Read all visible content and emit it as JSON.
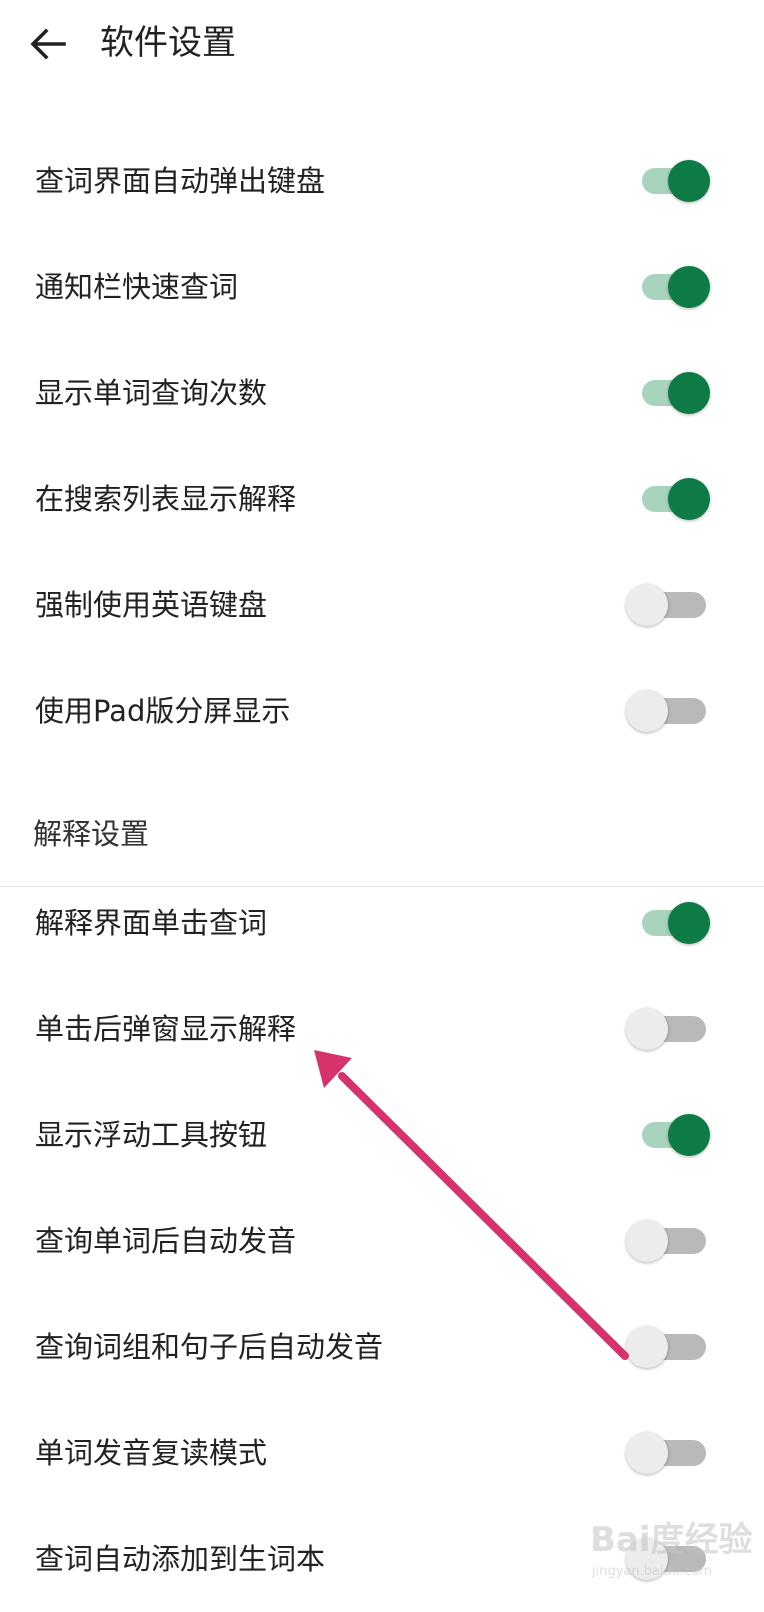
{
  "header": {
    "title": "软件设置",
    "back_icon": "arrow-left-icon"
  },
  "general_settings": [
    {
      "label": "查词界面自动弹出键盘",
      "enabled": true
    },
    {
      "label": "通知栏快速查词",
      "enabled": true
    },
    {
      "label": "显示单词查询次数",
      "enabled": true
    },
    {
      "label": "在搜索列表显示解释",
      "enabled": true
    },
    {
      "label": "强制使用英语键盘",
      "enabled": false
    },
    {
      "label": "使用Pad版分屏显示",
      "enabled": false
    }
  ],
  "section": {
    "title": "解释设置"
  },
  "explanation_settings": [
    {
      "label": "解释界面单击查词",
      "enabled": true
    },
    {
      "label": "单击后弹窗显示解释",
      "enabled": false
    },
    {
      "label": "显示浮动工具按钮",
      "enabled": true
    },
    {
      "label": "查询单词后自动发音",
      "enabled": false
    },
    {
      "label": "查询词组和句子后自动发音",
      "enabled": false
    },
    {
      "label": "单词发音复读模式",
      "enabled": false
    },
    {
      "label": "查词自动添加到生词本",
      "enabled": false
    }
  ],
  "colors": {
    "toggle_on_thumb": "#0e7a45",
    "toggle_on_track": "#a8d4bd",
    "toggle_off_thumb": "#ececec",
    "toggle_off_track": "#b9b9b9",
    "annotation_arrow": "#d6336c"
  },
  "watermark": {
    "logo": "Bai度经验",
    "url": "jingyan.baidu.com"
  }
}
